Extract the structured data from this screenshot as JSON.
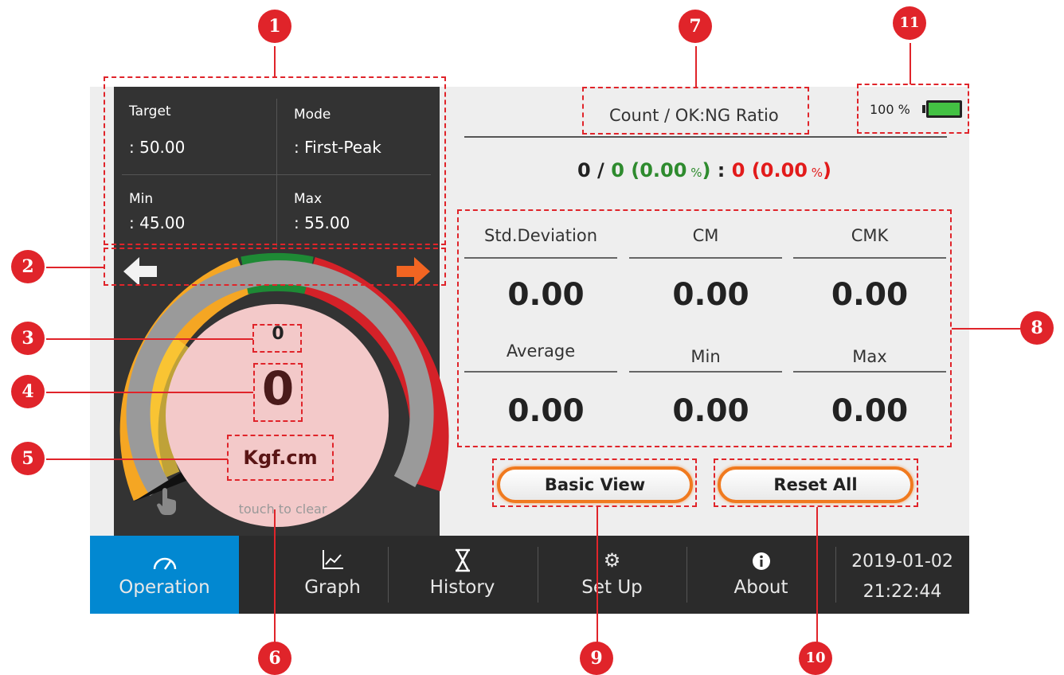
{
  "params": {
    "target_label": "Target",
    "target_value": ": 50.00",
    "mode_label": "Mode",
    "mode_value": ": First-Peak",
    "min_label": "Min",
    "min_value": ": 45.00",
    "max_label": "Max",
    "max_value": ": 55.00"
  },
  "gauge": {
    "peak_value": "0",
    "current_value": "0",
    "unit": "Kgf.cm",
    "clear_hint": "touch to clear"
  },
  "count": {
    "header": "Count / OK:NG Ratio",
    "total": "0",
    "slash": " / ",
    "ok_count": "0",
    "ok_pct": " (0.00",
    "pct_sign": " %",
    "close": ")",
    "colon": " : ",
    "ng_count": "0",
    "ng_pct": " (0.00"
  },
  "battery": {
    "text": "100 %",
    "level": 1.0
  },
  "stats": {
    "std_label": "Std.Deviation",
    "std_value": "0.00",
    "cm_label": "CM",
    "cm_value": "0.00",
    "cmk_label": "CMK",
    "cmk_value": "0.00",
    "avg_label": "Average",
    "avg_value": "0.00",
    "min_label": "Min",
    "min_value": "0.00",
    "max_label": "Max",
    "max_value": "0.00"
  },
  "buttons": {
    "basic_view": "Basic View",
    "reset_all": "Reset All"
  },
  "nav": {
    "operation": "Operation",
    "graph": "Graph",
    "history": "History",
    "setup": "Set Up",
    "about": "About",
    "date": "2019-01-02",
    "time": "21:22:44"
  },
  "callouts": [
    "1",
    "2",
    "3",
    "4",
    "5",
    "6",
    "7",
    "8",
    "9",
    "10",
    "11"
  ],
  "colors": {
    "accent": "#0288d1",
    "ok": "#2e8b2e",
    "ng": "#e21b1b",
    "callout": "#e0242a",
    "button_ring": "#f07a1f"
  }
}
